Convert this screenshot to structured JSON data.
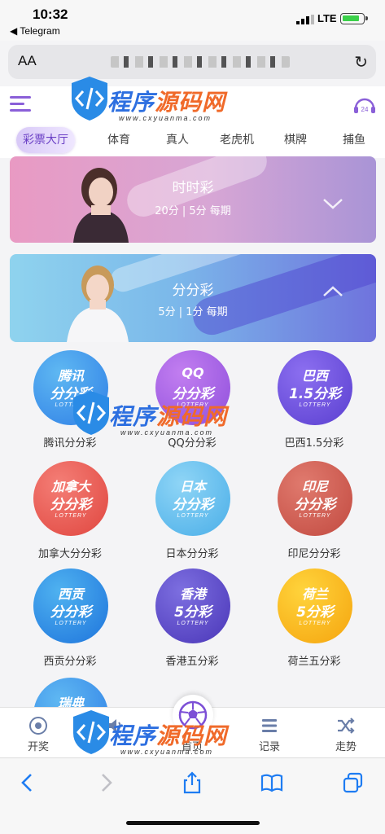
{
  "status_bar": {
    "time": "10:32",
    "back_app": "◀ Telegram",
    "network": "LTE"
  },
  "browser": {
    "aa_label": "AA",
    "reload_icon": "reload-icon"
  },
  "nav_tabs": [
    {
      "label": "彩票大厅",
      "active": true
    },
    {
      "label": "体育"
    },
    {
      "label": "真人"
    },
    {
      "label": "老虎机"
    },
    {
      "label": "棋牌"
    },
    {
      "label": "捕鱼"
    }
  ],
  "service_badge": "24",
  "banners": [
    {
      "title": "时时彩",
      "subtitle": "20分 | 5分 每期",
      "expanded": false
    },
    {
      "title": "分分彩",
      "subtitle": "5分 | 1分 每期",
      "expanded": true
    }
  ],
  "games": [
    {
      "line1": "腾讯",
      "line2": "分分彩",
      "badge": "LOTTERY",
      "label": "腾讯分分彩",
      "color1": "#5fb8f2",
      "color2": "#2f7fe6"
    },
    {
      "line1": "QQ",
      "line2": "分分彩",
      "badge": "LOTTERY",
      "label": "QQ分分彩",
      "color1": "#c27ef0",
      "color2": "#8f4fdc"
    },
    {
      "line1": "巴西",
      "line2": "1.5分彩",
      "badge": "LOTTERY",
      "label": "巴西1.5分彩",
      "color1": "#8c6ff0",
      "color2": "#5a3fd0"
    },
    {
      "line1": "加拿大",
      "line2": "分分彩",
      "badge": "LOTTERY",
      "label": "加拿大分分彩",
      "color1": "#f47e76",
      "color2": "#e0463f"
    },
    {
      "line1": "日本",
      "line2": "分分彩",
      "badge": "LOTTERY",
      "label": "日本分分彩",
      "color1": "#8fd5f6",
      "color2": "#4aaee8"
    },
    {
      "line1": "印尼",
      "line2": "分分彩",
      "badge": "LOTTERY",
      "label": "印尼分分彩",
      "color1": "#e07a6e",
      "color2": "#c24a40"
    },
    {
      "line1": "西贡",
      "line2": "分分彩",
      "badge": "LOTTERY",
      "label": "西贡分分彩",
      "color1": "#4fb2f0",
      "color2": "#1e74dc"
    },
    {
      "line1": "香港",
      "line2": "5分彩",
      "badge": "LOTTERY",
      "label": "香港五分彩",
      "color1": "#7d6fe0",
      "color2": "#4a36b8"
    },
    {
      "line1": "荷兰",
      "line2": "5分彩",
      "badge": "LOTTERY",
      "label": "荷兰五分彩",
      "color1": "#ffd43c",
      "color2": "#f5a40e"
    },
    {
      "line1": "瑞典",
      "line2": "",
      "badge": "",
      "label": "",
      "color1": "#5fb8f2",
      "color2": "#2f7fe6"
    }
  ],
  "bottom_nav": [
    {
      "label": "开奖",
      "icon": "lottery-ball-icon"
    },
    {
      "label": "",
      "icon": "speaker-icon"
    },
    {
      "label": "首页",
      "icon": "soccer-ball-icon"
    },
    {
      "label": "记录",
      "icon": "list-icon"
    },
    {
      "label": "走势",
      "icon": "shuffle-icon"
    }
  ],
  "watermark": {
    "text_a": "程序",
    "text_b": "源码网",
    "url": "www.cxyuanma.com"
  },
  "colors": {
    "accent": "#8a5fd8",
    "active_tab_text": "#6a3fc5"
  }
}
